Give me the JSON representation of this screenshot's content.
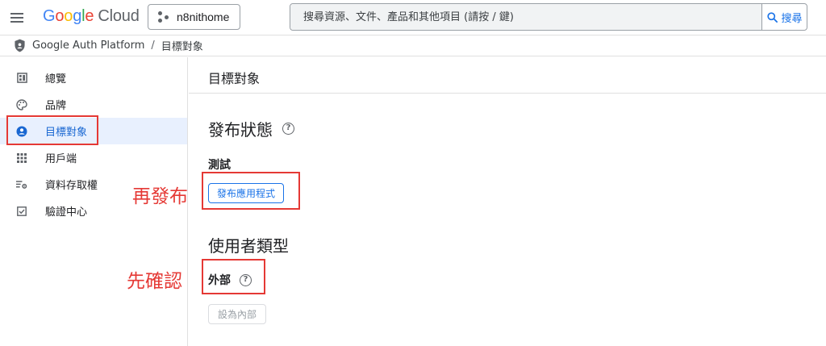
{
  "header": {
    "logo": {
      "letters": [
        "G",
        "o",
        "o",
        "g",
        "l",
        "e"
      ],
      "product": "Cloud"
    },
    "project_name": "n8nithome",
    "search_placeholder": "搜尋資源、文件、產品和其他項目 (請按 / 鍵)",
    "search_button": "搜尋"
  },
  "breadcrumb": {
    "product": "Google Auth Platform",
    "separator": "/",
    "page": "目標對象"
  },
  "sidebar": {
    "items": [
      {
        "label": "總覽",
        "icon": "dashboard-icon",
        "active": false
      },
      {
        "label": "品牌",
        "icon": "palette-icon",
        "active": false
      },
      {
        "label": "目標對象",
        "icon": "account-circle-icon",
        "active": true
      },
      {
        "label": "用戶端",
        "icon": "apps-grid-icon",
        "active": false
      },
      {
        "label": "資料存取權",
        "icon": "data-access-settings-icon",
        "active": false
      },
      {
        "label": "驗證中心",
        "icon": "checkbox-icon",
        "active": false
      }
    ]
  },
  "main": {
    "title": "目標對象",
    "publishing_status": {
      "heading": "發布狀態",
      "value": "測試",
      "publish_button": "發布應用程式"
    },
    "user_type": {
      "heading": "使用者類型",
      "value": "外部",
      "make_internal_button": "設為內部"
    }
  },
  "annotations": {
    "republish_label": "再發布",
    "confirm_first_label": "先確認",
    "color": "#e53935"
  },
  "colors": {
    "accent": "#1a73e8",
    "active_bg": "#e8f0fe",
    "annotation": "#e53935"
  }
}
